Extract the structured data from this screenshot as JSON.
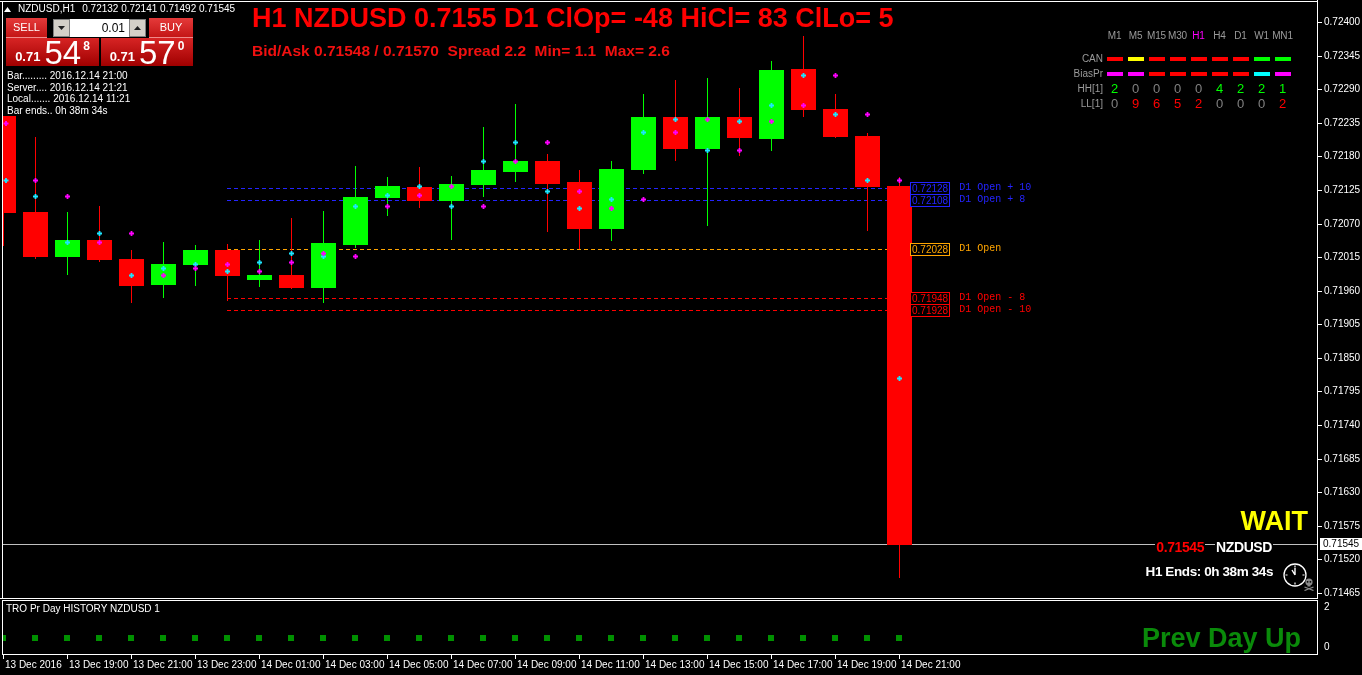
{
  "chart_header": {
    "symbol": "NZDUSD,H1",
    "ohlc": "0.72132 0.72141 0.71492 0.71545"
  },
  "trade_panel": {
    "sell": {
      "label": "SELL",
      "price_prefix": "0.71",
      "price_main": "54",
      "price_sup": "8"
    },
    "lot": {
      "value": "0.01"
    },
    "buy": {
      "label": "BUY",
      "price_prefix": "0.71",
      "price_main": "57",
      "price_sup": "0"
    }
  },
  "info_lines": [
    "Bar......... 2016.12.14 21:00",
    "Server.... 2016.12.14 21:21",
    "Local....... 2016.12.14 11:21",
    "Bar ends.. 0h 38m 34s"
  ],
  "headline": "H1 NZDUSD 0.7155 D1 ClOp= -48 HiCl= 83 ClLo= 5",
  "quote_line": "Bid/Ask 0.71548 / 0.71570  Spread 2.2  Min= 1.1  Max= 2.6",
  "timeframe_panel": {
    "timeframes": [
      {
        "label": "M1",
        "selected": false
      },
      {
        "label": "M5",
        "selected": false
      },
      {
        "label": "M15",
        "selected": false
      },
      {
        "label": "M30",
        "selected": false
      },
      {
        "label": "H1",
        "selected": true
      },
      {
        "label": "H4",
        "selected": false
      },
      {
        "label": "D1",
        "selected": false
      },
      {
        "label": "W1",
        "selected": false
      },
      {
        "label": "MN1",
        "selected": false
      }
    ],
    "rows": [
      {
        "label": "CAN",
        "kind": "dashes",
        "cells": [
          {
            "color": "#ff0000"
          },
          {
            "color": "#ffff00"
          },
          {
            "color": "#ff0000"
          },
          {
            "color": "#ff0000"
          },
          {
            "color": "#ff0000"
          },
          {
            "color": "#ff0000"
          },
          {
            "color": "#ff0000"
          },
          {
            "color": "#00ff00"
          },
          {
            "color": "#00ff00"
          }
        ]
      },
      {
        "label": "BiasPr",
        "kind": "dashes",
        "cells": [
          {
            "color": "#ff00ff"
          },
          {
            "color": "#ff00ff"
          },
          {
            "color": "#ff0000"
          },
          {
            "color": "#ff0000"
          },
          {
            "color": "#ff0000"
          },
          {
            "color": "#ff0000"
          },
          {
            "color": "#ff0000"
          },
          {
            "color": "#00ffff"
          },
          {
            "color": "#ff00ff"
          }
        ]
      },
      {
        "label": "HH[1]",
        "kind": "counts",
        "cells": [
          {
            "text": "2",
            "color": "#00ff00"
          },
          {
            "text": "0",
            "color": "#808080"
          },
          {
            "text": "0",
            "color": "#808080"
          },
          {
            "text": "0",
            "color": "#808080"
          },
          {
            "text": "0",
            "color": "#808080"
          },
          {
            "text": "4",
            "color": "#00ff00"
          },
          {
            "text": "2",
            "color": "#00ff00"
          },
          {
            "text": "2",
            "color": "#00ff00"
          },
          {
            "text": "1",
            "color": "#00ff00"
          }
        ]
      },
      {
        "label": "LL[1]",
        "kind": "counts",
        "cells": [
          {
            "text": "0",
            "color": "#808080"
          },
          {
            "text": "9",
            "color": "#ff0000"
          },
          {
            "text": "6",
            "color": "#ff0000"
          },
          {
            "text": "5",
            "color": "#ff0000"
          },
          {
            "text": "2",
            "color": "#ff0000"
          },
          {
            "text": "0",
            "color": "#808080"
          },
          {
            "text": "0",
            "color": "#808080"
          },
          {
            "text": "0",
            "color": "#808080"
          },
          {
            "text": "2",
            "color": "#ff0000"
          }
        ]
      }
    ]
  },
  "levels": [
    {
      "price": "0.72128",
      "label": "D1 Open + 10",
      "color": "#2424ff"
    },
    {
      "price": "0.72108",
      "label": "D1 Open + 8",
      "color": "#2424ff"
    },
    {
      "price": "0.72028",
      "label": "D1 Open",
      "color": "#ffa500"
    },
    {
      "price": "0.71948",
      "label": "D1 Open - 8",
      "color": "#ff0000"
    },
    {
      "price": "0.71928",
      "label": "D1 Open - 10",
      "color": "#ff0000"
    }
  ],
  "status_overlay": {
    "signal": "WAIT",
    "price": "0.71545",
    "symbol": "NZDUSD",
    "timer": "H1 Ends: 0h 38m 34s"
  },
  "price_axis": {
    "ticks": [
      "0.72400",
      "0.72345",
      "0.72290",
      "0.72235",
      "0.72180",
      "0.72125",
      "0.72070",
      "0.72015",
      "0.71960",
      "0.71905",
      "0.71850",
      "0.71795",
      "0.71740",
      "0.71685",
      "0.71630",
      "0.71575",
      "0.71520",
      "0.71465"
    ],
    "current": "0.71545"
  },
  "indicator": {
    "title": "TRO Pr Day HISTORY NZDUSD 1",
    "status": "Prev Day Up",
    "axis_labels": [
      "2",
      "0"
    ]
  },
  "time_axis": [
    "13 Dec 2016",
    "13 Dec 19:00",
    "13 Dec 21:00",
    "13 Dec 23:00",
    "14 Dec 01:00",
    "14 Dec 03:00",
    "14 Dec 05:00",
    "14 Dec 07:00",
    "14 Dec 09:00",
    "14 Dec 11:00",
    "14 Dec 13:00",
    "14 Dec 15:00",
    "14 Dec 17:00",
    "14 Dec 19:00",
    "14 Dec 21:00"
  ]
}
